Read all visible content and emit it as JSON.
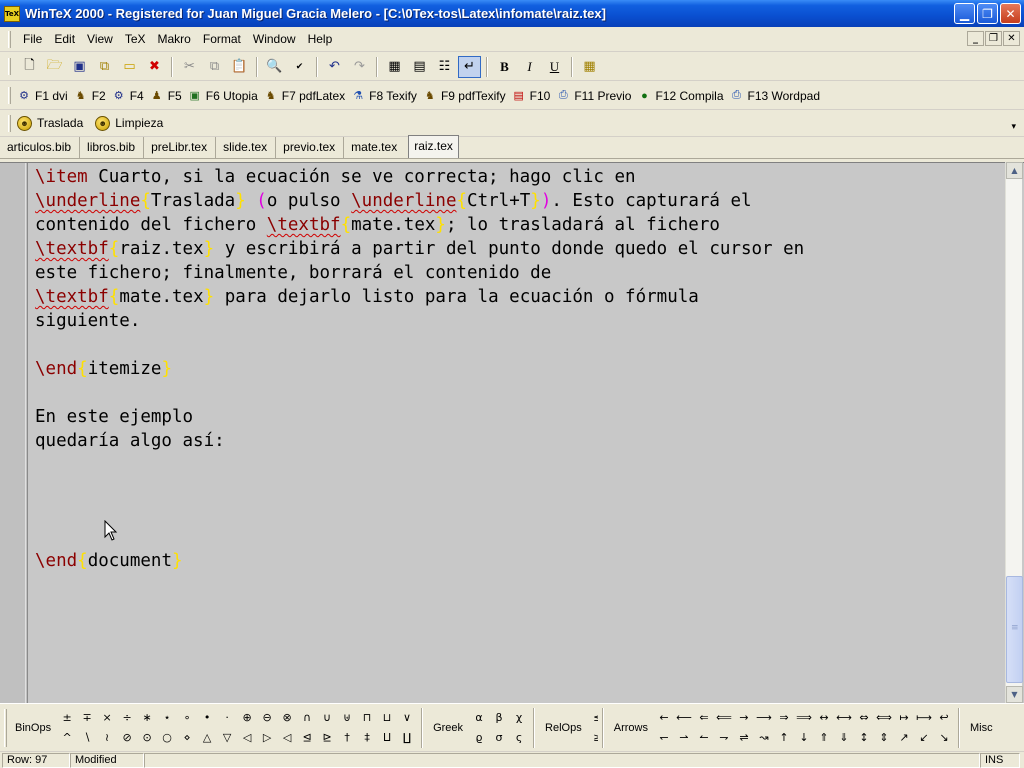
{
  "window": {
    "title": "WinTeX 2000 - Registered for Juan Miguel Gracia Melero - [C:\\0Tex-tos\\Latex\\infomate\\raiz.tex]",
    "app_icon_text": "TeX"
  },
  "menu": [
    "File",
    "Edit",
    "View",
    "TeX",
    "Makro",
    "Format",
    "Window",
    "Help"
  ],
  "toolbar_main": {
    "bold": "B",
    "italic": "I",
    "underline": "U"
  },
  "function_keys": [
    {
      "label": "F1 dvi",
      "icon": "dvi-icon"
    },
    {
      "label": "F2",
      "icon": "tex-compile-icon"
    },
    {
      "label": "F4",
      "icon": "bibtex-icon"
    },
    {
      "label": "F5",
      "icon": "gnome-icon"
    },
    {
      "label": "F6 Utopia",
      "icon": "utopia-icon"
    },
    {
      "label": "F7 pdfLatex",
      "icon": "pdflatex-icon"
    },
    {
      "label": "F8 Texify",
      "icon": "texify-icon"
    },
    {
      "label": "F9 pdfTexify",
      "icon": "pdftexify-icon"
    },
    {
      "label": "F10",
      "icon": "acrobat-icon"
    },
    {
      "label": "F11 Previo",
      "icon": "preview-icon"
    },
    {
      "label": "F12 Compila",
      "icon": "compile-ball-icon"
    },
    {
      "label": "F13 Wordpad",
      "icon": "wordpad-icon"
    }
  ],
  "user_tools": [
    {
      "label": "Traslada",
      "icon": "smiley-icon"
    },
    {
      "label": "Limpieza",
      "icon": "smiley-icon"
    }
  ],
  "tabs": [
    {
      "label": "articulos.bib",
      "active": false
    },
    {
      "label": "libros.bib",
      "active": false
    },
    {
      "label": "preLibr.tex",
      "active": false
    },
    {
      "label": "slide.tex",
      "active": false
    },
    {
      "label": "previo.tex",
      "active": false
    },
    {
      "label": "mate.tex",
      "active": false
    },
    {
      "label": "raiz.tex",
      "active": true
    }
  ],
  "editor": {
    "lines": [
      "\\item Cuarto, si la ecuación se ve correcta; hago clic en",
      "\\underline{Traslada} (o pulso \\underline{Ctrl+T}). Esto capturará el",
      "contenido del fichero \\textbf{mate.tex}; lo trasladará al fichero",
      "\\textbf{raiz.tex} y escribirá a partir del punto donde quedo el cursor en",
      "este fichero; finalmente, borrará el contenido de",
      "\\textbf{mate.tex} para dejarlo listo para la ecuación o fórmula",
      "siguiente.",
      "",
      "\\end{itemize}",
      "",
      "En este ejemplo",
      "quedaría algo así:",
      "",
      "",
      "",
      "",
      "\\end{document}"
    ],
    "colors": {
      "command": "#8b0000",
      "brace": "#ffe100",
      "paren": "#e000e0",
      "background": "#c8c8c8"
    }
  },
  "palette": {
    "binops_label": "BinOps",
    "binops": [
      "±",
      "^",
      "∓",
      "∖",
      "×",
      "≀",
      "÷",
      "⊘",
      "∗",
      "⊙",
      "⋆",
      "○",
      "∘",
      "⋄",
      "•",
      "△",
      "·",
      "▽",
      "⊕",
      "◁",
      "⊖",
      "▷",
      "⊗",
      "◁",
      "∩",
      "⊴",
      "∪",
      "⊵",
      "⊎",
      "†",
      "⊓",
      "‡",
      "⊔",
      "⨿",
      "∨",
      "∐"
    ],
    "greek_label": "Greek",
    "greek": [
      "α",
      "ϱ",
      "β",
      "σ",
      "χ",
      "ς"
    ],
    "relops_label": "RelOps",
    "relops": [
      "≤",
      "≥"
    ],
    "arrows_label": "Arrows",
    "arrows": [
      "←",
      "↽",
      "⟵",
      "⇀",
      "⇐",
      "↼",
      "⟸",
      "⇁",
      "→",
      "⇌",
      "⟶",
      "↝",
      "⇒",
      "↑",
      "⟹",
      "↓",
      "↔",
      "⇑",
      "⟷",
      "⇓",
      "⇔",
      "↕",
      "⟺",
      "⇕",
      "↦",
      "↗",
      "⟼",
      "↙",
      "↩",
      "↘"
    ],
    "misc_label": "Misc"
  },
  "status": {
    "row": "Row: 97",
    "modified": "Modified",
    "mode": "INS"
  }
}
